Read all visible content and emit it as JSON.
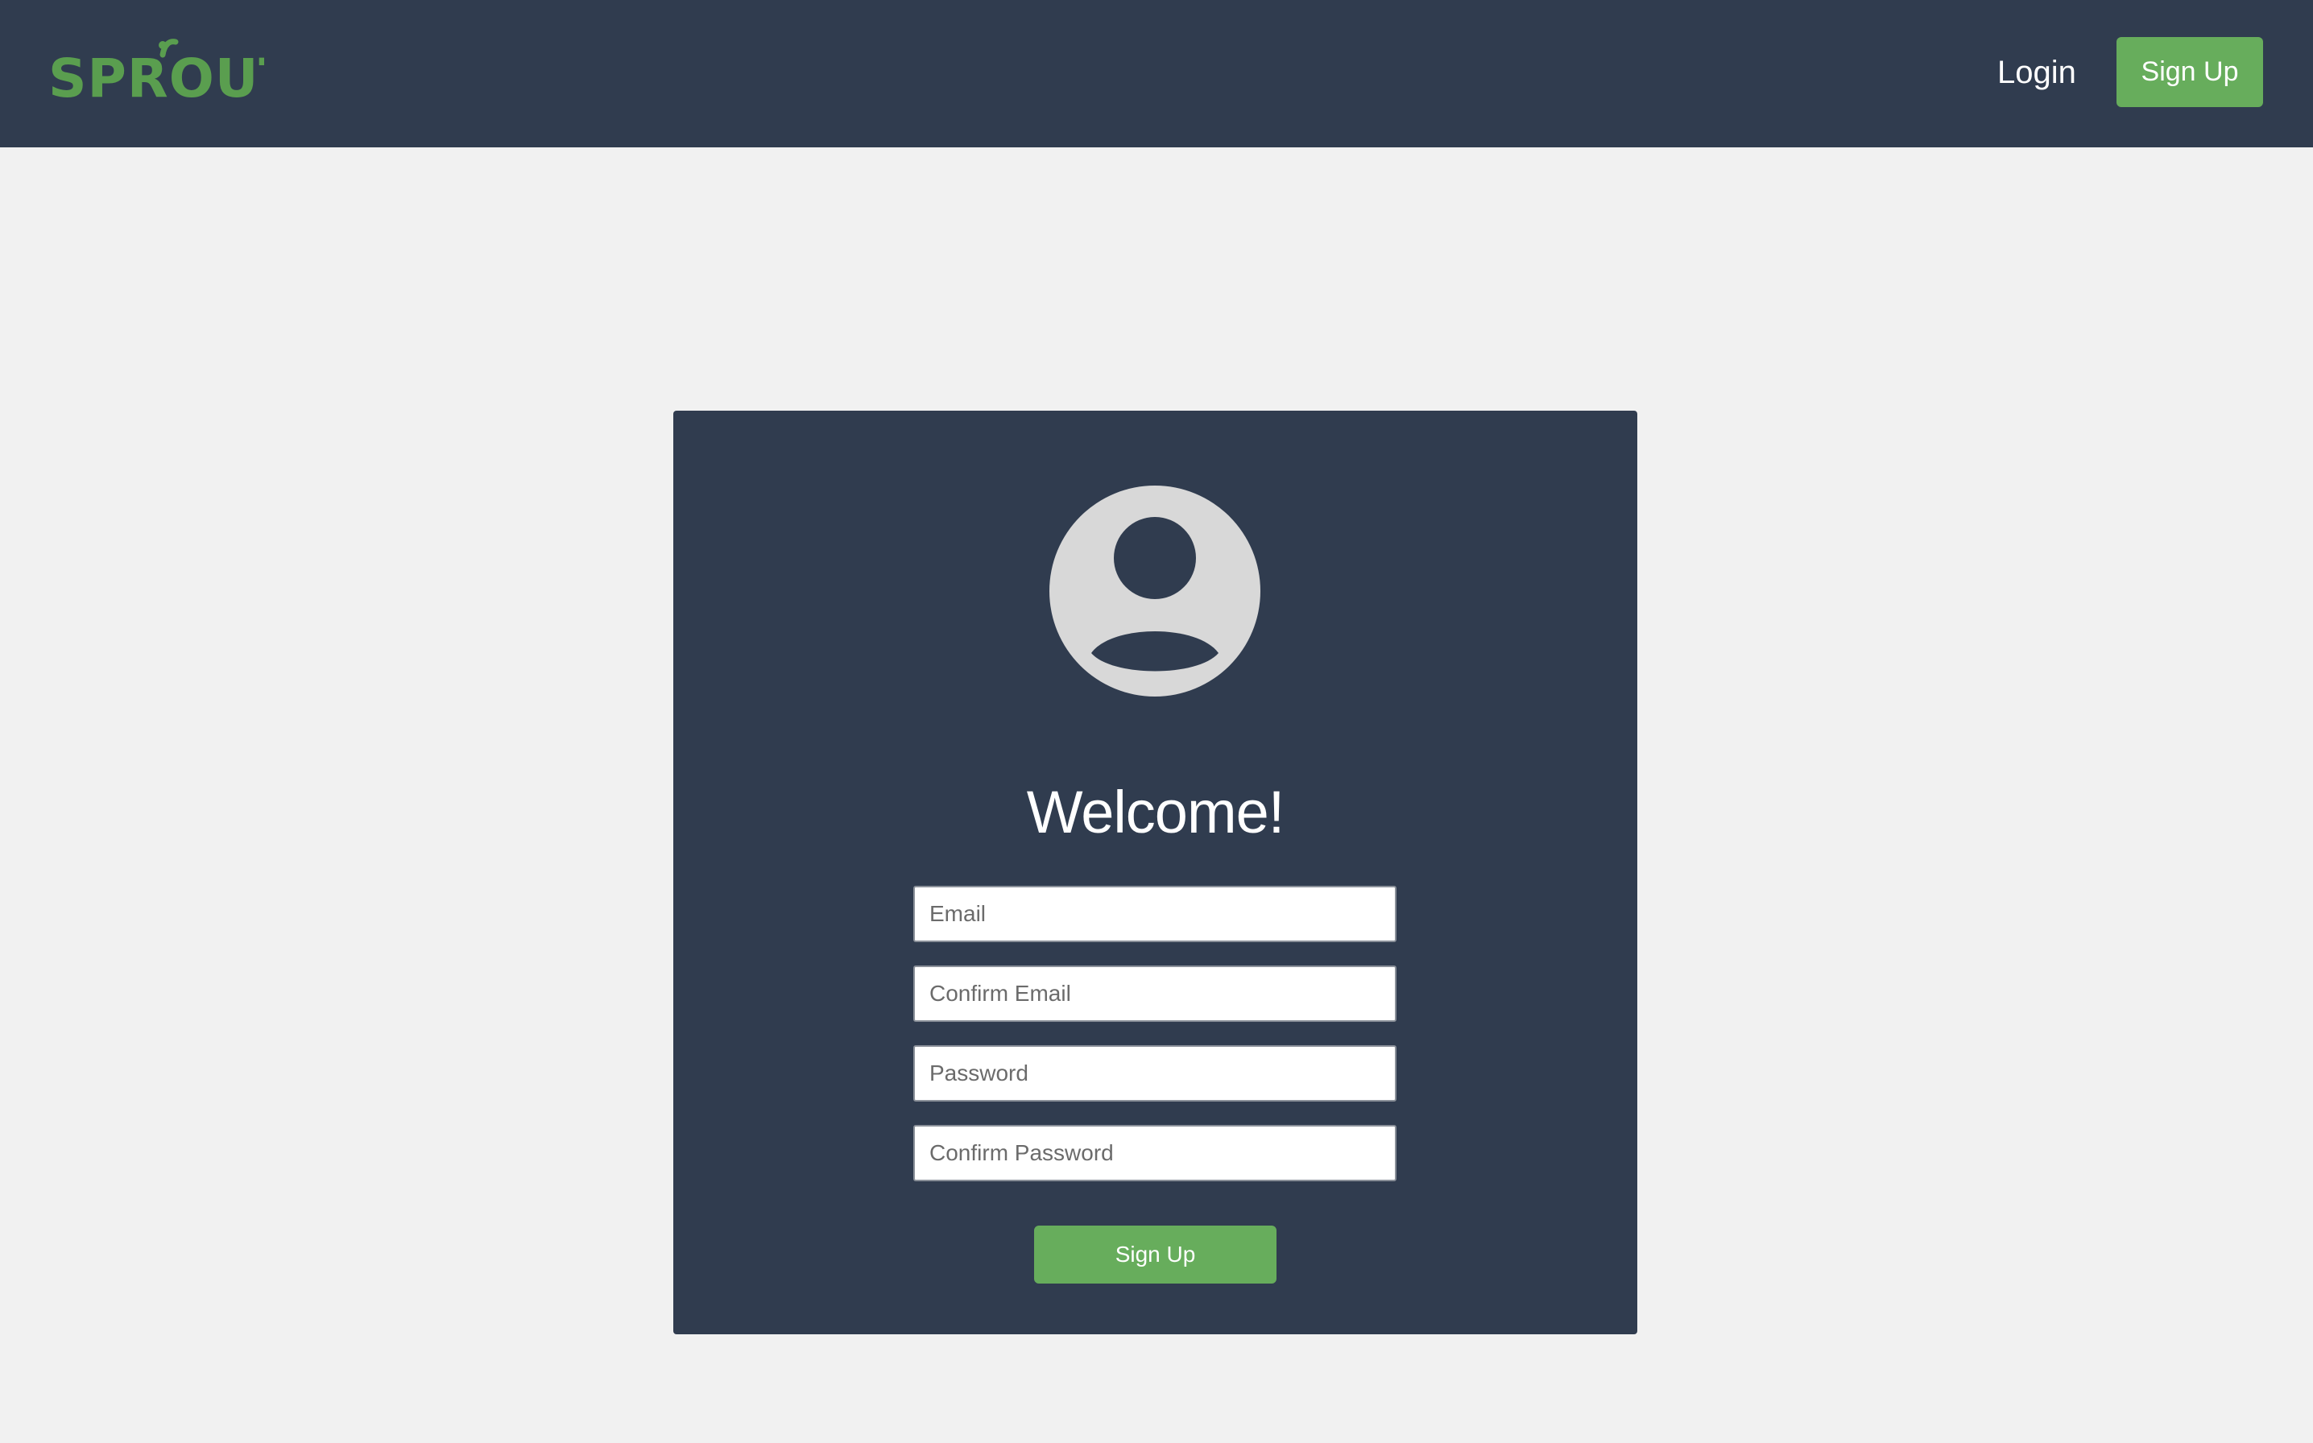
{
  "brand": {
    "name": "SPROUT",
    "color": "#5a9e4f"
  },
  "nav": {
    "login_label": "Login",
    "signup_label": "Sign Up"
  },
  "card": {
    "avatar_icon": "user-circle-icon",
    "heading": "Welcome!",
    "fields": [
      {
        "placeholder": "Email",
        "value": ""
      },
      {
        "placeholder": "Confirm Email",
        "value": ""
      },
      {
        "placeholder": "Password",
        "value": ""
      },
      {
        "placeholder": "Confirm Password",
        "value": ""
      }
    ],
    "submit_label": "Sign Up"
  },
  "colors": {
    "navbar": "#303c4f",
    "card": "#303c4f",
    "accent": "#67ad5c",
    "background": "#f1f1f1",
    "avatar": "#d8d8d8"
  }
}
